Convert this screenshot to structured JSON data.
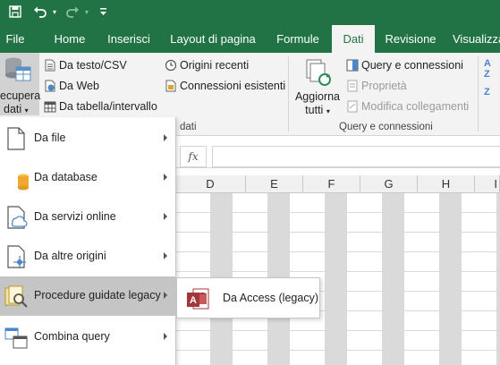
{
  "qat": {
    "save_icon": "save-icon",
    "undo_icon": "undo-icon",
    "redo_icon": "redo-icon",
    "customize_icon": "customize-qat-icon"
  },
  "tabs": [
    {
      "label": "File"
    },
    {
      "label": "Home"
    },
    {
      "label": "Inserisci"
    },
    {
      "label": "Layout di pagina"
    },
    {
      "label": "Formule"
    },
    {
      "label": "Dati",
      "active": true
    },
    {
      "label": "Revisione"
    },
    {
      "label": "Visualizza"
    }
  ],
  "ribbon": {
    "get_data": {
      "line1": "ecupera",
      "line2": "dati"
    },
    "from_text_csv": "Da testo/CSV",
    "from_web": "Da Web",
    "from_table_range": "Da tabella/intervallo",
    "recent_sources": "Origini recenti",
    "existing_connections": "Connessioni esistenti",
    "group_get_transform_partial": "dati",
    "refresh_all": {
      "line1": "Aggiorna",
      "line2": "tutti"
    },
    "queries_connections": "Query e connessioni",
    "properties": "Proprietà",
    "edit_links": "Modifica collegamenti",
    "group_queries_connections": "Query e connessioni",
    "sort_az": "A",
    "sort_za": "Z"
  },
  "formula_bar": {
    "fx": "fx",
    "value": ""
  },
  "columns": [
    "D",
    "E",
    "F",
    "G",
    "H",
    "I"
  ],
  "menu": {
    "items": [
      {
        "label": "Da file",
        "icon": "file-icon"
      },
      {
        "label": "Da database",
        "icon": "database-icon"
      },
      {
        "label": "Da servizi online",
        "icon": "cloud-icon"
      },
      {
        "label": "Da altre origini",
        "icon": "other-sources-icon"
      },
      {
        "label": "Procedure guidate legacy",
        "icon": "legacy-wizard-icon",
        "highlighted": true
      },
      {
        "label": "Combina query",
        "icon": "combine-queries-icon"
      }
    ]
  },
  "submenu": {
    "items": [
      {
        "label": "Da Access (legacy)",
        "icon": "access-icon"
      }
    ]
  },
  "colors": {
    "brand": "#217346",
    "ribbon_bg": "#f3f3f3",
    "menu_highlight": "#c5c5c5"
  }
}
